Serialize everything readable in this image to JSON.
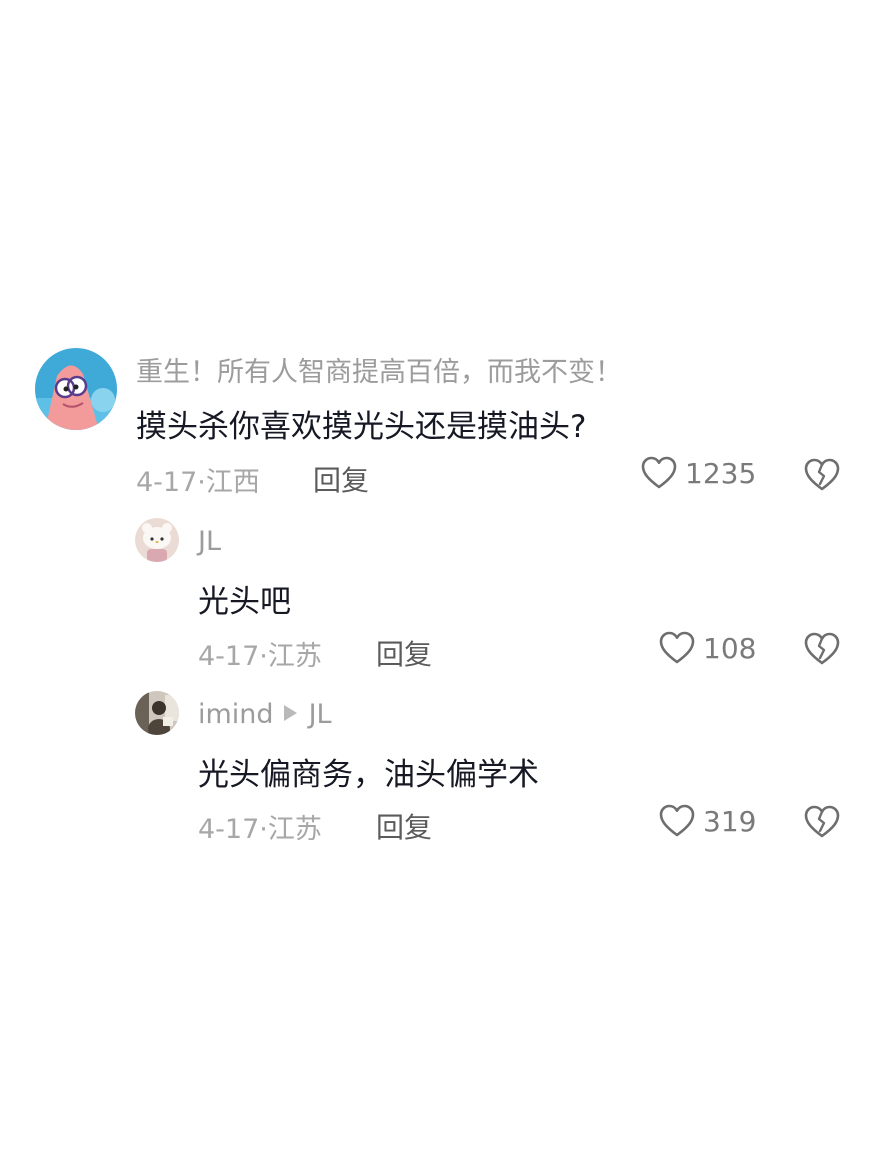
{
  "comments": [
    {
      "username": "重生！所有人智商提高百倍，而我不变！",
      "text": "摸头杀你喜欢摸光头还是摸油头?",
      "date": "4-17",
      "location": "江西",
      "reply_label": "回复",
      "likes": "1235"
    },
    {
      "username": "JL",
      "text": "光头吧",
      "date": "4-17",
      "location": "江苏",
      "reply_label": "回复",
      "likes": "108"
    },
    {
      "username": "imind",
      "reply_to": "JL",
      "text": "光头偏商务，油头偏学术",
      "date": "4-17",
      "location": "江苏",
      "reply_label": "回复",
      "likes": "319"
    }
  ],
  "meta_separator": "·",
  "colors": {
    "text": "#161823",
    "secondary": "#a7a7a7",
    "username": "#9c9c9c"
  },
  "icons": {
    "like": "heart-outline-icon",
    "dislike": "broken-heart-icon",
    "reply_arrow": "triangle-right-icon"
  }
}
